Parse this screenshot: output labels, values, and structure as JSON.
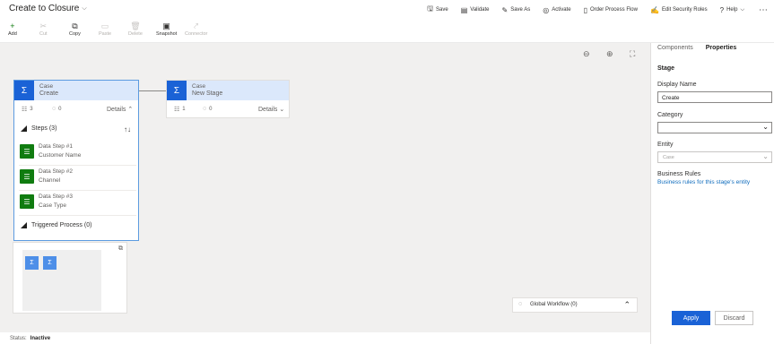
{
  "header": {
    "title": "Create to Closure",
    "commands": [
      {
        "label": "Save",
        "icon": "save-icon",
        "glyph": "🖫"
      },
      {
        "label": "Validate",
        "icon": "validate-icon",
        "glyph": "▤"
      },
      {
        "label": "Save As",
        "icon": "save-as-icon",
        "glyph": "✎"
      },
      {
        "label": "Activate",
        "icon": "activate-icon",
        "glyph": "◎"
      },
      {
        "label": "Order Process Flow",
        "icon": "order-process-flow-icon",
        "glyph": "▯"
      },
      {
        "label": "Edit Security Roles",
        "icon": "edit-security-roles-icon",
        "glyph": "✍"
      },
      {
        "label": "Help",
        "icon": "help-icon",
        "glyph": "?"
      }
    ],
    "more_glyph": "⋯"
  },
  "toolbar": {
    "items": [
      {
        "label": "Add",
        "icon": "add-icon",
        "glyph": "+",
        "disabled": false
      },
      {
        "label": "Cut",
        "icon": "cut-icon",
        "glyph": "✂",
        "disabled": true
      },
      {
        "label": "Copy",
        "icon": "copy-icon",
        "glyph": "⧉",
        "disabled": false
      },
      {
        "label": "Paste",
        "icon": "paste-icon",
        "glyph": "▭",
        "disabled": true
      },
      {
        "label": "Delete",
        "icon": "delete-icon",
        "glyph": "🗑",
        "disabled": true
      },
      {
        "label": "Snapshot",
        "icon": "snapshot-icon",
        "glyph": "▣",
        "disabled": false
      },
      {
        "label": "Connector",
        "icon": "connector-icon",
        "glyph": "⤤",
        "disabled": true
      }
    ]
  },
  "canvas": {
    "stages": [
      {
        "entity": "Case",
        "name": "Create",
        "steps_count": "3",
        "loops_count": "0",
        "details_label": "Details",
        "steps_header": "Steps (3)",
        "steps": [
          {
            "title": "Data Step #1",
            "field": "Customer Name"
          },
          {
            "title": "Data Step #2",
            "field": "Channel"
          },
          {
            "title": "Data Step #3",
            "field": "Case Type"
          }
        ],
        "triggered_label": "Triggered Process (0)"
      },
      {
        "entity": "Case",
        "name": "New Stage",
        "steps_count": "1",
        "loops_count": "0",
        "details_label": "Details"
      }
    ],
    "global_workflow_label": "Global Workflow (0)"
  },
  "status": {
    "label": "Status:",
    "value": "Inactive"
  },
  "panel": {
    "tabs": [
      "Components",
      "Properties"
    ],
    "active_tab": "Properties",
    "section_title": "Stage",
    "display_name_label": "Display Name",
    "display_name_value": "Create",
    "category_label": "Category",
    "category_value": "",
    "entity_label": "Entity",
    "entity_value": "Case",
    "business_rules_label": "Business Rules",
    "business_rules_link": "Business rules for this stage's entity",
    "apply_label": "Apply",
    "discard_label": "Discard"
  },
  "colors": {
    "accent": "#1a62d6",
    "stage_header_bg": "#dbe8fb",
    "step_icon_green": "#107c10",
    "canvas_bg": "#f1f0ef",
    "link": "#0f6cbd"
  }
}
